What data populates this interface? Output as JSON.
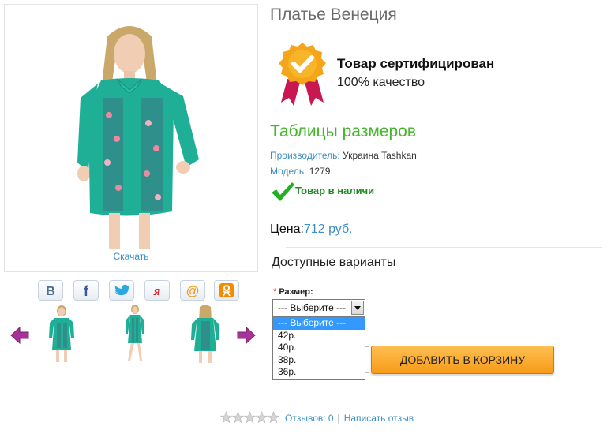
{
  "product": {
    "title": "Платье Венеция",
    "download_label": "Скачать"
  },
  "share": [
    {
      "icon": "vk-icon",
      "glyph": "В",
      "color": "#4c6c91"
    },
    {
      "icon": "facebook-icon",
      "glyph": "f",
      "color": "#3b5998"
    },
    {
      "icon": "twitter-icon",
      "glyph": "",
      "color": "#2aa9e0"
    },
    {
      "icon": "yaru-icon",
      "glyph": "я",
      "color": "#e31e24"
    },
    {
      "icon": "mailru-icon",
      "glyph": "@",
      "color": "#f59c1a"
    },
    {
      "icon": "odnoklassniki-icon",
      "glyph": "",
      "color": "#f28b00"
    }
  ],
  "certification": {
    "title": "Товар сертифицирован",
    "subtitle": "100% качество"
  },
  "size_tables_label": "Таблицы размеров",
  "manufacturer": {
    "label": "Производитель:",
    "value": "Украина Tashkan"
  },
  "model": {
    "label": "Модель:",
    "value": "1279"
  },
  "stock_status": "Товар в наличи",
  "price": {
    "label": "Цена:",
    "value": "712 руб."
  },
  "variants": {
    "title": "Доступные варианты",
    "size_label": "Размер:",
    "required_mark": "*",
    "selected": "--- Выберите ---",
    "options": [
      "--- Выберите ---",
      "42р.",
      "40р.",
      "38р.",
      "36р."
    ]
  },
  "add_to_cart_label": "ДОБАВИТЬ В КОРЗИНУ",
  "reviews": {
    "rating": 0,
    "max_rating": 5,
    "count_label": "Отзывов: 0",
    "separator": "|",
    "write_label": "Написать отзыв"
  },
  "colors": {
    "link": "#3a8fc7",
    "green_heading": "#45b52b",
    "in_stock": "#1c8b1c",
    "cart_button": "#f79a18",
    "dress": "#1fae96",
    "arrow": "#a8329a"
  }
}
